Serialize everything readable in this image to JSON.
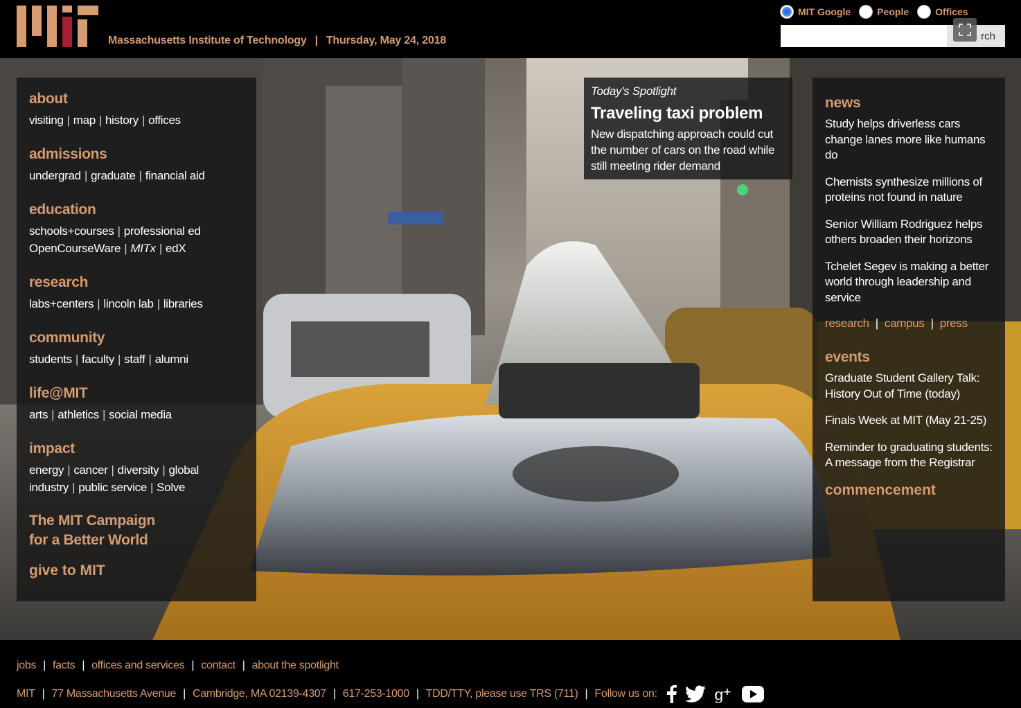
{
  "header": {
    "institute": "Massachusetts Institute of Technology",
    "date": "Thursday, May 24, 2018",
    "search_options": [
      {
        "label": "MIT Google",
        "selected": true
      },
      {
        "label": "People",
        "selected": false
      },
      {
        "label": "Offices",
        "selected": false
      }
    ],
    "search_value": "",
    "search_button": "rch"
  },
  "nav": {
    "about": {
      "title": "about",
      "links": [
        "visiting",
        "map",
        "history",
        "offices"
      ]
    },
    "admissions": {
      "title": "admissions",
      "links": [
        "undergrad",
        "graduate",
        "financial aid"
      ]
    },
    "education": {
      "title": "education",
      "links_row1": [
        "schools+courses",
        "professional ed"
      ],
      "links_row2": [
        "OpenCourseWare",
        "MITx",
        "edX"
      ]
    },
    "research": {
      "title": "research",
      "links": [
        "labs+centers",
        "lincoln lab",
        "libraries"
      ]
    },
    "community": {
      "title": "community",
      "links": [
        "students",
        "faculty",
        "staff",
        "alumni"
      ]
    },
    "life": {
      "title": "life@MIT",
      "links": [
        "arts",
        "athletics",
        "social media"
      ]
    },
    "impact": {
      "title": "impact",
      "links_row1": [
        "energy",
        "cancer",
        "diversity",
        "global"
      ],
      "links_row2": [
        "industry",
        "public service",
        "Solve"
      ]
    },
    "campaign_line1": "The MIT Campaign",
    "campaign_line2": "for a Better World",
    "give": "give to MIT"
  },
  "spotlight": {
    "label": "Today's Spotlight",
    "title": "Traveling taxi problem",
    "description": "New dispatching approach could cut the number of cars on the road while still meeting rider demand"
  },
  "news": {
    "title": "news",
    "items": [
      "Study helps driverless cars change lanes more like humans do",
      "Chemists synthesize millions of proteins not found in nature",
      "Senior William Rodriguez helps others broaden their horizons",
      "Tchelet Segev is making a better world through leadership and service"
    ],
    "sub_links": [
      "research",
      "campus",
      "press"
    ]
  },
  "events": {
    "title": "events",
    "items": [
      "Graduate Student Gallery Talk: History Out of Time (today)",
      "Finals Week at MIT (May 21-25)",
      "Reminder to graduating students: A message from the Registrar"
    ]
  },
  "commencement": "commencement",
  "footer": {
    "links": [
      "jobs",
      "facts",
      "offices and services",
      "contact",
      "about the spotlight"
    ],
    "info": [
      "MIT",
      "77 Massachusetts Avenue",
      "Cambridge, MA 02139-4307",
      "617-253-1000",
      "TDD/TTY, please use TRS (711)"
    ],
    "follow": "Follow us on:",
    "social_icons": [
      "facebook-icon",
      "twitter-icon",
      "google-plus-icon",
      "youtube-icon"
    ]
  },
  "colors": {
    "accent": "#d69b70",
    "logo_red": "#a31f34",
    "logo_tan": "#d69b70"
  }
}
